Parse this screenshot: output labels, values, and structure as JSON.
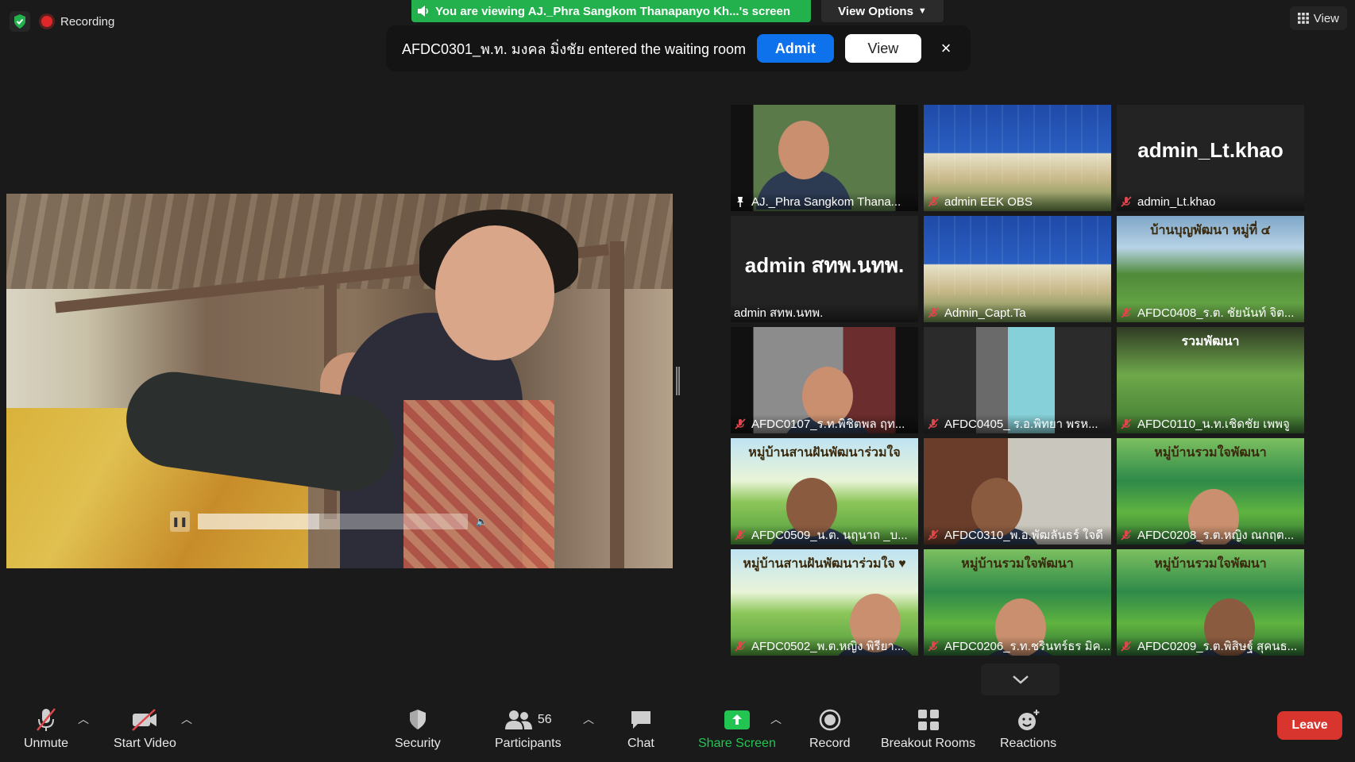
{
  "status": {
    "recording_label": "Recording"
  },
  "share_banner": {
    "text": "You are viewing AJ._Phra Sangkom Thanapanyo Kh...'s screen"
  },
  "view_options": {
    "label": "View Options"
  },
  "view_button": {
    "label": "View"
  },
  "waiting_room": {
    "message": "AFDC0301_พ.ท. มงคล  มิ่งชัย entered the waiting room",
    "admit_label": "Admit",
    "view_label": "View",
    "close_symbol": "×"
  },
  "gallery": {
    "tiles": [
      {
        "name": "AJ._Phra Sangkom Thana...",
        "active": true
      },
      {
        "name": "admin EEK OBS"
      },
      {
        "name": "admin_Lt.khao",
        "display_text": "admin_Lt.khao"
      },
      {
        "name": "admin สทพ.นทพ.",
        "display_text": "admin สทพ.นทพ."
      },
      {
        "name": "Admin_Capt.Ta"
      },
      {
        "name": "AFDC0408_ร.ต. ชัยนันท์ จิต...",
        "banner": "บ้านบุญพัฒนา หมู่ที่ ๔"
      },
      {
        "name": "AFDC0107_ร.ท.พิชิตพล ฤท..."
      },
      {
        "name": "AFDC0405_ ร.อ.พิทยา พรห..."
      },
      {
        "name": "AFDC0110_น.ท.เชิดชัย  เพพจู",
        "banner": "รวมพัฒนา"
      },
      {
        "name": "AFDC0509_น.ต. นฤนาถ  _บ...",
        "banner": "หมู่บ้านสานฝันพัฒนาร่วมใจ"
      },
      {
        "name": "AFDC0310_พ.อ.พัฒลันธร์ ใจดี"
      },
      {
        "name": "AFDC0208_ร.ต.หญิง ณกฤต...",
        "banner": "หมู่บ้านรวมใจพัฒนา"
      },
      {
        "name": "AFDC0502_พ.ต.หญิง พิรียา...",
        "banner": "หมู่บ้านสานฝันพัฒนาร่วมใจ ♥"
      },
      {
        "name": "AFDC0206_ร.ท.ชรินทร์ธร มิค...",
        "banner": "หมู่บ้านรวมใจพัฒนา"
      },
      {
        "name": "AFDC0209_ร.ต.พิสิษฐ์ สุคนธ...",
        "banner": "หมู่บ้านรวมใจพัฒนา"
      }
    ]
  },
  "toolbar": {
    "unmute": "Unmute",
    "start_video": "Start Video",
    "security": "Security",
    "participants": "Participants",
    "participants_count": "56",
    "chat": "Chat",
    "share_screen": "Share Screen",
    "record": "Record",
    "breakout_rooms": "Breakout Rooms",
    "reactions": "Reactions",
    "leave": "Leave"
  },
  "colors": {
    "share_green": "#23b14d",
    "admit_blue": "#0e72ed",
    "leave_red": "#d8352e",
    "active_speaker": "#d2ea6a",
    "mute_red": "#e0474c"
  },
  "video": {
    "progress": 0.45
  }
}
